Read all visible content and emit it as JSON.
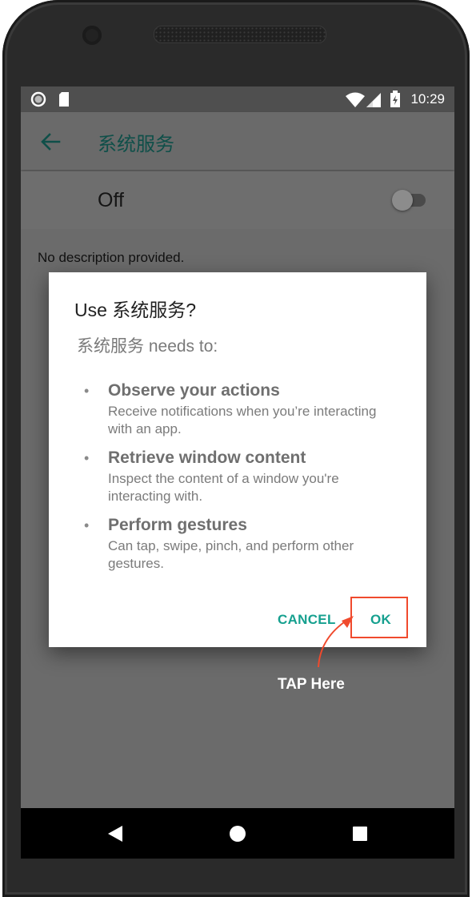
{
  "status_bar": {
    "time": "10:29",
    "icons": [
      "circle-notification-icon",
      "sd-card-icon",
      "wifi-icon",
      "cell-signal-icon",
      "battery-charging-icon"
    ]
  },
  "app_bar": {
    "back_icon": "arrow-back-icon",
    "title": "系统服务",
    "title_color": "#0f4f49"
  },
  "switch_row": {
    "label": "Off",
    "state": "off"
  },
  "description": "No description provided.",
  "dialog": {
    "title": "Use 系统服务?",
    "subtitle": "系统服务 needs to:",
    "permissions": [
      {
        "title": "Observe your actions",
        "desc": "Receive notifications when you’re interacting with an app."
      },
      {
        "title": "Retrieve window content",
        "desc": "Inspect the content of a window you're interacting with."
      },
      {
        "title": "Perform gestures",
        "desc": "Can tap, swipe, pinch, and perform other gestures."
      }
    ],
    "cancel_label": "CANCEL",
    "ok_label": "OK",
    "accent_color": "#16a08f"
  },
  "annotation": {
    "text": "TAP Here",
    "color": "#f04a2d"
  },
  "nav_bar": {
    "icons": [
      "back-triangle-icon",
      "home-circle-icon",
      "recents-square-icon"
    ]
  }
}
